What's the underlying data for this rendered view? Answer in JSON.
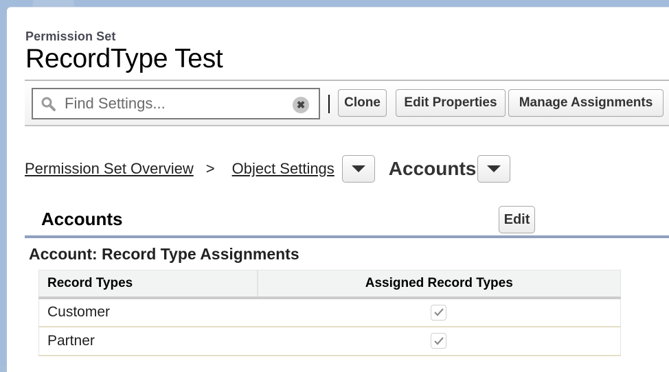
{
  "header": {
    "entity_label": "Permission Set",
    "title": "RecordType Test"
  },
  "toolbar": {
    "search": {
      "value": "",
      "placeholder": "Find Settings...",
      "search_icon": "magnifier-icon",
      "clear_icon": "close-circle-icon",
      "clear_glyph": "✖"
    },
    "buttons": {
      "clone": "Clone",
      "edit_properties": "Edit Properties",
      "manage_assignments": "Manage Assignments"
    }
  },
  "breadcrumb": {
    "items": [
      {
        "label": "Permission Set Overview",
        "link": true
      },
      {
        "label": "Object Settings",
        "link": true,
        "has_dropdown": true
      },
      {
        "label": "Accounts",
        "link": false,
        "has_dropdown": true,
        "current": true
      }
    ],
    "separator": ">"
  },
  "section": {
    "title": "Accounts",
    "edit_label": "Edit",
    "accent_color": "#8fa0bf"
  },
  "record_type_assignments": {
    "title": "Account: Record Type Assignments",
    "columns": [
      "Record Types",
      "Assigned Record Types"
    ],
    "rows": [
      {
        "record_type": "Customer",
        "assigned": true
      },
      {
        "record_type": "Partner",
        "assigned": true
      }
    ]
  }
}
